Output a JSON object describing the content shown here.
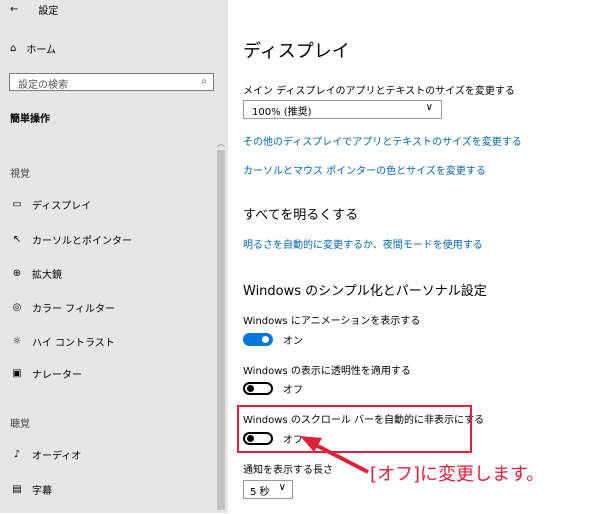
{
  "sidebar": {
    "back_label": "設定",
    "home": "ホーム",
    "search_placeholder": "設定の検索",
    "group_title": "簡単操作",
    "section_vision": "視覚",
    "section_hearing": "聴覚",
    "items": [
      "ディスプレイ",
      "カーソルとポインター",
      "拡大鏡",
      "カラー フィルター",
      "ハイ コントラスト",
      "ナレーター",
      "オーディオ",
      "字幕"
    ]
  },
  "main": {
    "title": "ディスプレイ",
    "size_label": "メイン ディスプレイのアプリとテキストのサイズを変更する",
    "size_value": "100% (推奨)",
    "link_other_size": "その他のディスプレイでアプリとテキストのサイズを変更する",
    "link_cursor": "カーソルとマウス ポインターの色とサイズを変更する",
    "bright_heading": "すべてを明るくする",
    "link_night": "明るさを自動的に変更するか、夜間モードを使用する",
    "simplify_heading": "Windows のシンプル化とパーソナル設定",
    "anim_label": "Windows にアニメーションを表示する",
    "anim_state": "オン",
    "transp_label": "Windows の表示に透明性を適用する",
    "transp_state": "オフ",
    "scrollbar_label": "Windows のスクロール バーを自動的に非表示にする",
    "scrollbar_state": "オフ",
    "notify_label": "通知を表示する長さ",
    "notify_value": "5 秒"
  },
  "annotation": {
    "text": "[オフ]に変更します。",
    "color": "#e0203a"
  }
}
